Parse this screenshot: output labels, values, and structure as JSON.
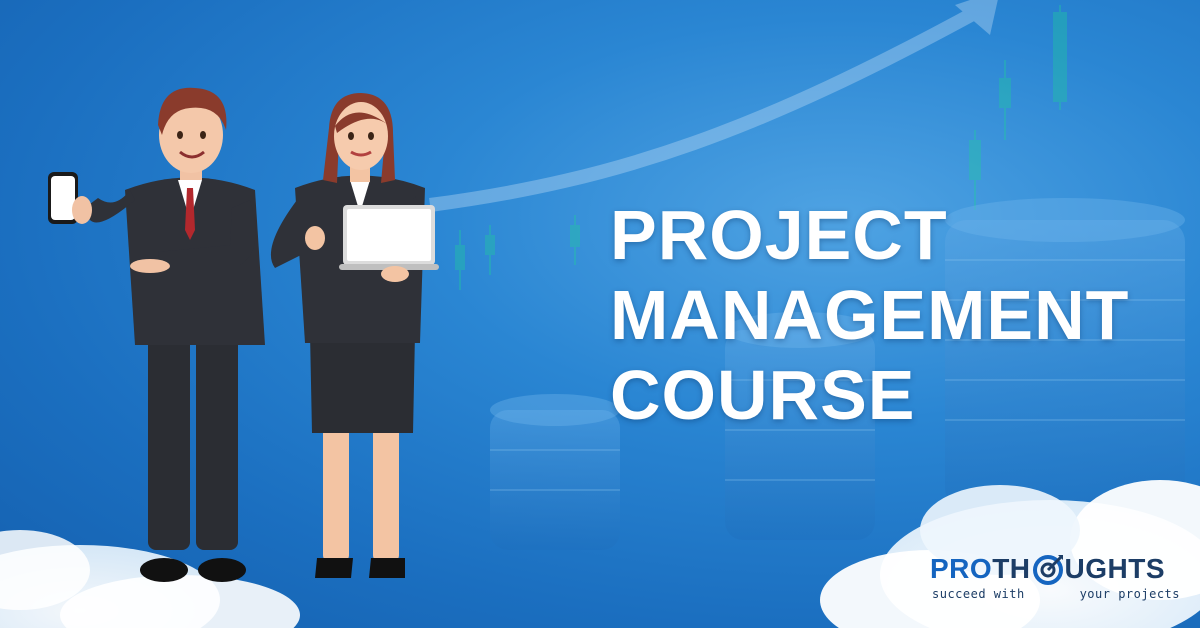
{
  "headline": {
    "line1": "PROJECT",
    "line2": "MANAGEMENT",
    "line3": "COURSE"
  },
  "logo": {
    "pro": "PRO",
    "th": "TH",
    "ughts": "UGHTS",
    "tagline_left": "succeed with",
    "tagline_right": "your projects"
  },
  "colors": {
    "background": "#1b6fc0",
    "headline": "#ffffff",
    "logo_pro": "#1565c0",
    "logo_dark": "#1c3d66",
    "suit": "#2b2d33"
  },
  "icons": [
    "trend-arrow-icon",
    "candlestick-chart-icon",
    "coin-stack-icon",
    "cloud-icon",
    "smartphone-icon",
    "laptop-icon",
    "target-o-icon"
  ]
}
